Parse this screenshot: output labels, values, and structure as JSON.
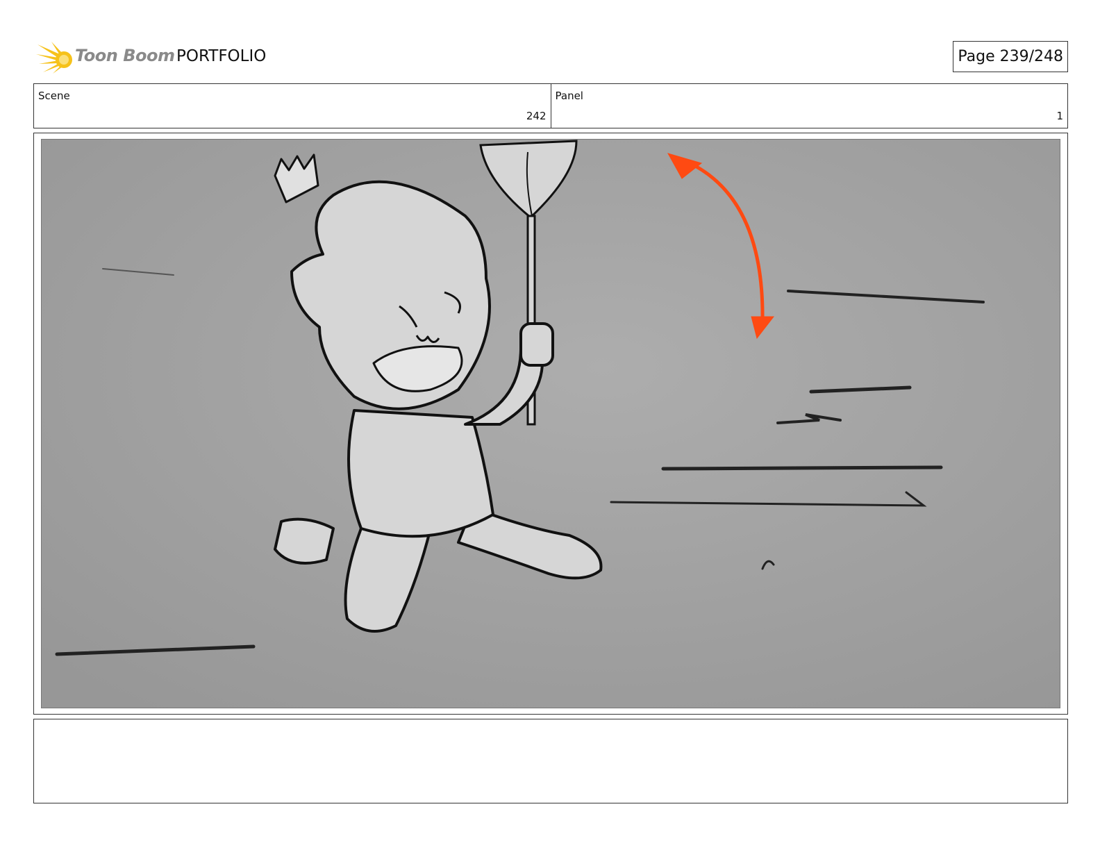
{
  "header": {
    "logo_text": "Toon Boom",
    "title": "PORTFOLIO",
    "page_label": "Page 239/248",
    "logo_icon": "toon-boom-starburst-icon",
    "logo_color": "#f6c21a"
  },
  "info": {
    "scene_label": "Scene",
    "scene_value": "242",
    "panel_label": "Panel",
    "panel_value": "1"
  },
  "panel": {
    "image_description_icon": "storyboard-sketch",
    "arrow_color": "#ff4a12",
    "background_color": "#a6a6a6"
  },
  "notes": {
    "text": ""
  }
}
